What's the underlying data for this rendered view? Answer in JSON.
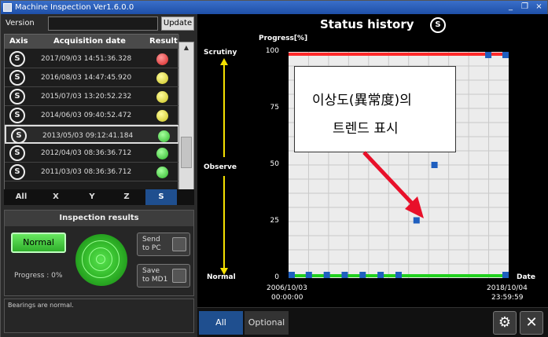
{
  "window": {
    "title": "Machine Inspection Ver1.6.0.0",
    "minimize": "_",
    "restore": "❐",
    "close": "×"
  },
  "version": {
    "label": "Version",
    "value": "",
    "update_label": "Update"
  },
  "history": {
    "headers": [
      "Axis",
      "Acquisition date",
      "Result"
    ],
    "axis_glyph": "S",
    "rows": [
      {
        "date": "2017/09/03 14:51:36.328",
        "result": "red"
      },
      {
        "date": "2016/08/03 14:47:45.920",
        "result": "yellow"
      },
      {
        "date": "2015/07/03 13:20:52.232",
        "result": "yellow"
      },
      {
        "date": "2014/06/03 09:40:52.472",
        "result": "yellow"
      },
      {
        "date": "2013/05/03 09:12:41.184",
        "result": "green",
        "selected": true
      },
      {
        "date": "2012/04/03 08:36:36.712",
        "result": "green"
      },
      {
        "date": "2011/03/03 08:36:36.712",
        "result": "green"
      }
    ]
  },
  "axis_tabs": [
    {
      "label": "All",
      "active": false
    },
    {
      "label": "X",
      "active": false
    },
    {
      "label": "Y",
      "active": false
    },
    {
      "label": "Z",
      "active": false
    },
    {
      "label": "S",
      "active": true
    }
  ],
  "inspection": {
    "title": "Inspection results",
    "status": "Normal",
    "progress": "Progress : 0%",
    "send_l1": "Send",
    "send_l2": "to PC",
    "save_l1": "Save",
    "save_l2": "to MD1"
  },
  "message": "Bearings are normal.",
  "chart_panel": {
    "title": "Status history",
    "title_glyph": "S",
    "progress_label": "Progress[%]",
    "scrutiny": "Scrutiny",
    "observe": "Observe",
    "normal": "Normal",
    "date_axis": "Date",
    "start_date": "2006/10/03",
    "start_time": "00:00:00",
    "end_date": "2018/10/04",
    "end_time": "23:59:59",
    "callout_line1": "이상도(異常度)의",
    "callout_line2": "트렌드 표시",
    "mode_all": "All",
    "mode_optional": "Optional",
    "gear_glyph": "⚙",
    "close_glyph": "✕"
  },
  "chart_data": {
    "type": "scatter",
    "ylabel": "Progress[%]",
    "xlabel": "Date",
    "ylim": [
      0,
      100
    ],
    "yticks": [
      0,
      25,
      50,
      75,
      100
    ],
    "x_range": [
      "2006/10/03 00:00:00",
      "2018/10/04 23:59:59"
    ],
    "grid": true,
    "series": [
      {
        "color": "#1f5fbf",
        "points": [
          {
            "x": "2006/10/03",
            "y": 0
          },
          {
            "x": "2007/10/03",
            "y": 0
          },
          {
            "x": "2008/10/03",
            "y": 0
          },
          {
            "x": "2009/10/03",
            "y": 0
          },
          {
            "x": "2010/10/03",
            "y": 0
          },
          {
            "x": "2011/10/03",
            "y": 0
          },
          {
            "x": "2012/10/03",
            "y": 0
          },
          {
            "x": "2013/10/03",
            "y": 25
          },
          {
            "x": "2014/10/03",
            "y": 50
          },
          {
            "x": "2015/10/03",
            "y": 75
          },
          {
            "x": "2017/10/03",
            "y": 100
          },
          {
            "x": "2018/10/04",
            "y": 100
          },
          {
            "x": "2018/10/04",
            "y": 0
          }
        ]
      }
    ],
    "threshold_top_color": "#ff2a2a",
    "threshold_bottom_color": "#22d11f"
  }
}
